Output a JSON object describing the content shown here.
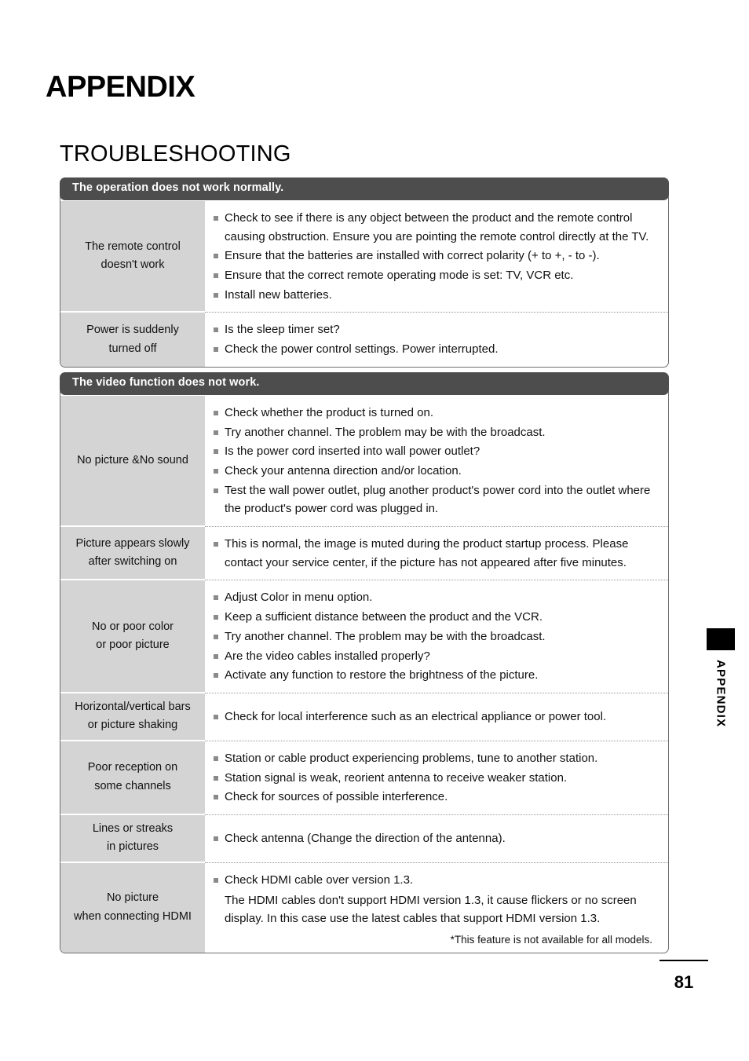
{
  "page": {
    "title": "APPENDIX",
    "section_title": "TROUBLESHOOTING",
    "side_tab_label": "APPENDIX",
    "page_number": "81"
  },
  "tables": [
    {
      "header": "The operation does not work normally.",
      "rows": [
        {
          "label": "The remote control\ndoesn't work",
          "label_lines": [
            "The remote control",
            "doesn't work"
          ],
          "bullets": [
            "Check to see if there is any object between the product and the remote control causing obstruction. Ensure you are pointing the remote control directly at the TV.",
            "Ensure that the batteries are installed with correct polarity (+ to +, - to -).",
            "Ensure that the correct remote operating mode is set: TV, VCR etc.",
            "Install new batteries."
          ]
        },
        {
          "label_lines": [
            "Power is suddenly",
            "turned off"
          ],
          "bullets": [
            "Is the sleep timer set?",
            "Check the power control settings. Power interrupted."
          ]
        }
      ]
    },
    {
      "header": "The video function does not work.",
      "rows": [
        {
          "label_lines": [
            "No picture &No sound"
          ],
          "bullets": [
            "Check whether the product is turned on.",
            "Try another channel. The problem may be with the broadcast.",
            "Is the power cord inserted into wall power outlet?",
            "Check your antenna direction and/or location.",
            "Test the wall power outlet, plug another product's power cord into the outlet where the product's power cord was plugged in."
          ]
        },
        {
          "label_lines": [
            "Picture appears slowly",
            "after switching on"
          ],
          "bullets": [
            "This is normal, the image is muted during the product startup process. Please contact your service center, if the picture has not appeared after five minutes."
          ]
        },
        {
          "label_lines": [
            "No or poor color",
            "or poor picture"
          ],
          "bullets": [
            "Adjust Color in menu option.",
            "Keep a sufficient distance between the product and the VCR.",
            "Try another channel. The problem may be with the broadcast.",
            "Are the video cables installed properly?",
            "Activate any function to restore the brightness of the picture."
          ]
        },
        {
          "label_lines": [
            "Horizontal/vertical bars",
            "or picture shaking"
          ],
          "bullets": [
            "Check for local interference such as an electrical appliance or power tool."
          ]
        },
        {
          "label_lines": [
            "Poor reception on",
            "some channels"
          ],
          "bullets": [
            "Station or cable product experiencing problems, tune to another station.",
            "Station signal is weak, reorient antenna to receive weaker station.",
            "Check for sources of possible interference."
          ]
        },
        {
          "label_lines": [
            "Lines or streaks",
            "in pictures"
          ],
          "bullets": [
            "Check antenna (Change the direction of the antenna)."
          ]
        },
        {
          "label_lines": [
            "No picture",
            "when connecting HDMI"
          ],
          "bullets": [
            "Check HDMI cable over version 1.3."
          ],
          "paragraphs": [
            "The HDMI cables don't support HDMI version 1.3, it cause flickers or no screen display. In this case use the latest cables that support HDMI version 1.3."
          ],
          "footnote": "*This feature is not available for all models."
        }
      ]
    }
  ],
  "colors": {
    "header_bar": "#4d4d4d",
    "label_cell": "#d4d4d4",
    "bullet": "#8a8a8a",
    "text": "#111111"
  }
}
